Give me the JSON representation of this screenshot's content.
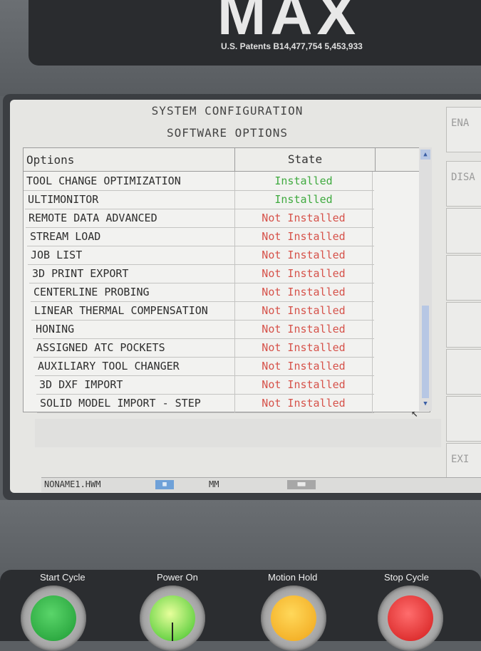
{
  "machine": {
    "brand": "MAX",
    "patents": "U.S. Patents B14,477,754 5,453,933"
  },
  "screen": {
    "title": "SYSTEM CONFIGURATION",
    "subtitle": "SOFTWARE OPTIONS"
  },
  "softkeys": [
    "ENA",
    "DISA",
    "",
    "",
    "",
    "",
    "",
    "",
    "EXI"
  ],
  "table": {
    "columns": [
      "Options",
      "State"
    ],
    "rows": [
      {
        "option": "TOOL CHANGE OPTIMIZATION",
        "state": "Installed"
      },
      {
        "option": "ULTIMONITOR",
        "state": "Installed"
      },
      {
        "option": "REMOTE DATA ADVANCED",
        "state": "Not Installed"
      },
      {
        "option": "STREAM LOAD",
        "state": "Not Installed"
      },
      {
        "option": "JOB LIST",
        "state": "Not Installed"
      },
      {
        "option": "3D PRINT EXPORT",
        "state": "Not Installed"
      },
      {
        "option": "CENTERLINE PROBING",
        "state": "Not Installed"
      },
      {
        "option": "LINEAR THERMAL COMPENSATION",
        "state": "Not Installed"
      },
      {
        "option": "HONING",
        "state": "Not Installed"
      },
      {
        "option": "ASSIGNED ATC POCKETS",
        "state": "Not Installed"
      },
      {
        "option": "AUXILIARY TOOL CHANGER",
        "state": "Not Installed"
      },
      {
        "option": "3D DXF IMPORT",
        "state": "Not Installed"
      },
      {
        "option": "SOLID MODEL IMPORT - STEP",
        "state": "Not Installed"
      }
    ]
  },
  "statusbar": {
    "file": "NONAME1.HWM",
    "unit": "MM"
  },
  "buttons": [
    {
      "label": "Start Cycle"
    },
    {
      "label": "Power On"
    },
    {
      "label": "Motion Hold"
    },
    {
      "label": "Stop Cycle"
    }
  ],
  "colors": {
    "installed": "#3faa3f",
    "not_installed": "#d6524a"
  }
}
